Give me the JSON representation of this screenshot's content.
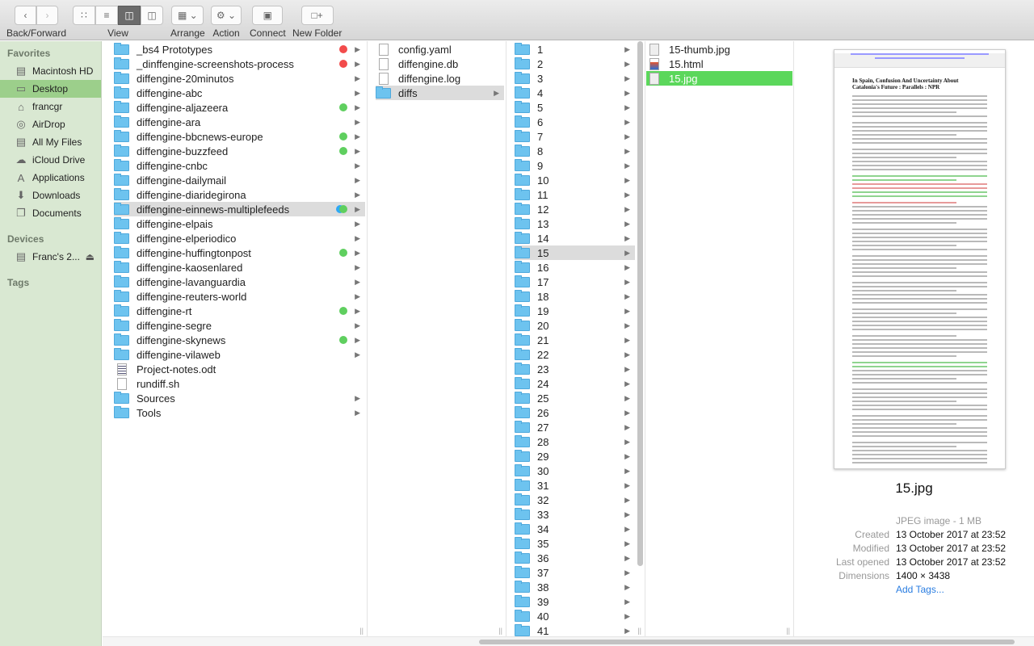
{
  "toolbar": {
    "back_forward": "Back/Forward",
    "view": "View",
    "arrange": "Arrange",
    "action": "Action",
    "connect": "Connect",
    "new_folder": "New Folder",
    "view_modes": [
      "icon",
      "list",
      "column",
      "cover-flow"
    ],
    "selected_view": "column"
  },
  "sidebar": {
    "favorites_header": "Favorites",
    "favorites": [
      {
        "label": "Macintosh HD",
        "icon": "hard-disk-icon"
      },
      {
        "label": "Desktop",
        "icon": "desktop-icon",
        "selected": true
      },
      {
        "label": "francgr",
        "icon": "home-icon"
      },
      {
        "label": "AirDrop",
        "icon": "airdrop-icon"
      },
      {
        "label": "All My Files",
        "icon": "all-files-icon"
      },
      {
        "label": "iCloud Drive",
        "icon": "cloud-icon"
      },
      {
        "label": "Applications",
        "icon": "applications-icon"
      },
      {
        "label": "Downloads",
        "icon": "downloads-icon"
      },
      {
        "label": "Documents",
        "icon": "documents-icon"
      }
    ],
    "devices_header": "Devices",
    "devices": [
      {
        "label": "Franc's 2...",
        "icon": "disk-icon"
      }
    ],
    "tags_header": "Tags"
  },
  "colors": {
    "accent": "#5bd75b",
    "sidebar_bg": "#d9e8d2",
    "sidebar_selected": "#9ccf8b",
    "tag_red": "#f24b4b",
    "tag_green": "#5fcf5f",
    "tag_blue": "#2fa8f5"
  },
  "column1": [
    {
      "label": "_bs4 Prototypes",
      "type": "folder",
      "tags": [
        "red"
      ]
    },
    {
      "label": "_dinffengine-screenshots-process",
      "type": "folder",
      "tags": [
        "red"
      ]
    },
    {
      "label": "diffengine-20minutos",
      "type": "folder",
      "tags": []
    },
    {
      "label": "diffengine-abc",
      "type": "folder",
      "tags": []
    },
    {
      "label": "diffengine-aljazeera",
      "type": "folder",
      "tags": [
        "green"
      ]
    },
    {
      "label": "diffengine-ara",
      "type": "folder",
      "tags": []
    },
    {
      "label": "diffengine-bbcnews-europe",
      "type": "folder",
      "tags": [
        "green"
      ]
    },
    {
      "label": "diffengine-buzzfeed",
      "type": "folder",
      "tags": [
        "green"
      ]
    },
    {
      "label": "diffengine-cnbc",
      "type": "folder",
      "tags": []
    },
    {
      "label": "diffengine-dailymail",
      "type": "folder",
      "tags": []
    },
    {
      "label": "diffengine-diaridegirona",
      "type": "folder",
      "tags": []
    },
    {
      "label": "diffengine-einnews-multiplefeeds",
      "type": "folder",
      "tags": [
        "blue",
        "green"
      ],
      "selected": true
    },
    {
      "label": "diffengine-elpais",
      "type": "folder",
      "tags": []
    },
    {
      "label": "diffengine-elperiodico",
      "type": "folder",
      "tags": []
    },
    {
      "label": "diffengine-huffingtonpost",
      "type": "folder",
      "tags": [
        "green"
      ]
    },
    {
      "label": "diffengine-kaosenlared",
      "type": "folder",
      "tags": []
    },
    {
      "label": "diffengine-lavanguardia",
      "type": "folder",
      "tags": []
    },
    {
      "label": "diffengine-reuters-world",
      "type": "folder",
      "tags": []
    },
    {
      "label": "diffengine-rt",
      "type": "folder",
      "tags": [
        "green"
      ]
    },
    {
      "label": "diffengine-segre",
      "type": "folder",
      "tags": []
    },
    {
      "label": "diffengine-skynews",
      "type": "folder",
      "tags": [
        "green"
      ]
    },
    {
      "label": "diffengine-vilaweb",
      "type": "folder",
      "tags": []
    },
    {
      "label": "Project-notes.odt",
      "type": "document",
      "tags": []
    },
    {
      "label": "rundiff.sh",
      "type": "file",
      "tags": []
    },
    {
      "label": "Sources",
      "type": "folder",
      "tags": []
    },
    {
      "label": "Tools",
      "type": "folder",
      "tags": []
    }
  ],
  "column2": [
    {
      "label": "config.yaml",
      "type": "file"
    },
    {
      "label": "diffengine.db",
      "type": "file"
    },
    {
      "label": "diffengine.log",
      "type": "file"
    },
    {
      "label": "diffs",
      "type": "folder",
      "selected": true
    }
  ],
  "column3": {
    "items": [
      "1",
      "2",
      "3",
      "4",
      "5",
      "6",
      "7",
      "8",
      "9",
      "10",
      "11",
      "12",
      "13",
      "14",
      "15",
      "16",
      "17",
      "18",
      "19",
      "20",
      "21",
      "22",
      "23",
      "24",
      "25",
      "26",
      "27",
      "28",
      "29",
      "30",
      "31",
      "32",
      "33",
      "34",
      "35",
      "36",
      "37",
      "38",
      "39",
      "40",
      "41"
    ],
    "selected": "15"
  },
  "column4": [
    {
      "label": "15-thumb.jpg",
      "type": "image"
    },
    {
      "label": "15.html",
      "type": "html"
    },
    {
      "label": "15.jpg",
      "type": "image",
      "selected": true
    }
  ],
  "preview": {
    "doc_title": "In Spain, Confusion And Uncertainty About Catalonia's Future : Parallels : NPR",
    "name": "15.jpg",
    "kind": "JPEG image - 1 MB",
    "info": [
      {
        "key": "Created",
        "value": "13 October 2017 at 23:52"
      },
      {
        "key": "Modified",
        "value": "13 October 2017 at 23:52"
      },
      {
        "key": "Last opened",
        "value": "13 October 2017 at 23:52"
      },
      {
        "key": "Dimensions",
        "value": "1400 × 3438"
      }
    ],
    "add_tags": "Add Tags..."
  }
}
